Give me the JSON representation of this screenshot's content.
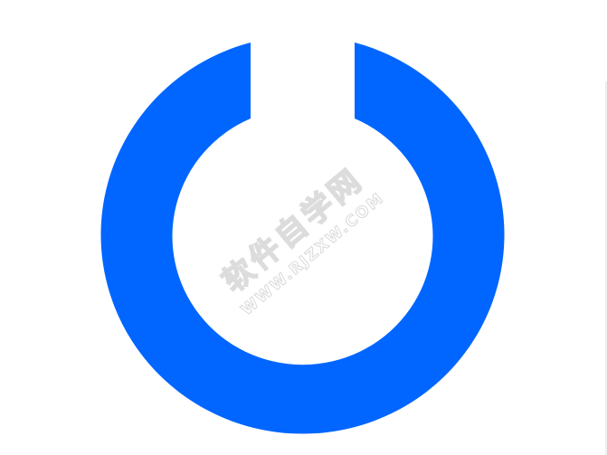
{
  "graphic": {
    "icon": "power-ring-icon",
    "ring_color": "#0066ff",
    "background_color": "#ffffff"
  },
  "watermark": {
    "text_cn": "软件自学网",
    "text_url": "WWW.RJZXW.COM",
    "color": "#dcdcdc"
  }
}
